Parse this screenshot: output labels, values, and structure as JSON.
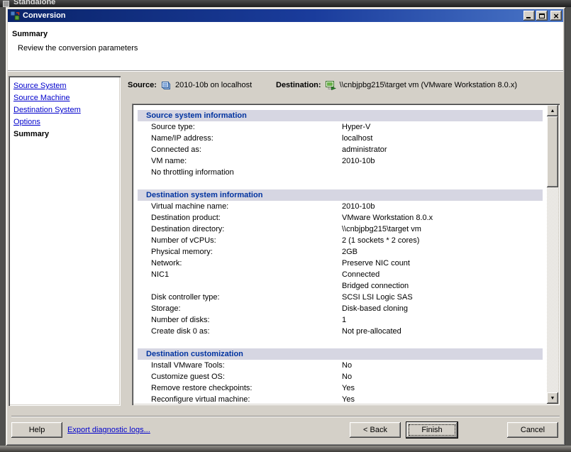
{
  "parent_window": {
    "title_visible": "Standalone"
  },
  "window": {
    "title": "Conversion"
  },
  "header": {
    "title": "Summary",
    "subtitle": "Review the conversion parameters"
  },
  "sidebar": {
    "items": [
      {
        "label": "Source System",
        "current": false
      },
      {
        "label": "Source Machine",
        "current": false
      },
      {
        "label": "Destination System",
        "current": false
      },
      {
        "label": "Options",
        "current": false
      },
      {
        "label": "Summary",
        "current": true
      }
    ]
  },
  "summary_bar": {
    "source_label": "Source:",
    "source_value": "2010-10b on localhost",
    "destination_label": "Destination:",
    "destination_value": "\\\\cnbjpbg215\\target vm (VMware Workstation 8.0.x)"
  },
  "content": {
    "sections": [
      {
        "title": "Source system information",
        "rows": [
          {
            "label": "Source type:",
            "value": "Hyper-V"
          },
          {
            "label": "Name/IP address:",
            "value": "localhost"
          },
          {
            "label": "Connected as:",
            "value": "administrator"
          },
          {
            "label": "VM name:",
            "value": "2010-10b"
          },
          {
            "label": "No throttling information",
            "value": ""
          }
        ]
      },
      {
        "title": "Destination system information",
        "rows": [
          {
            "label": "Virtual machine name:",
            "value": "2010-10b"
          },
          {
            "label": "Destination product:",
            "value": "VMware Workstation 8.0.x"
          },
          {
            "label": "Destination directory:",
            "value": "\\\\cnbjpbg215\\target vm"
          },
          {
            "label": "Number of vCPUs:",
            "value": "2 (1 sockets * 2 cores)"
          },
          {
            "label": "Physical memory:",
            "value": "2GB"
          },
          {
            "label": "Network:",
            "value": "Preserve NIC count"
          },
          {
            "label": "NIC1",
            "value": "Connected"
          },
          {
            "label": "",
            "value": "Bridged connection"
          },
          {
            "label": "Disk controller type:",
            "value": "SCSI LSI Logic SAS"
          },
          {
            "label": "Storage:",
            "value": "Disk-based cloning"
          },
          {
            "label": "Number of disks:",
            "value": "1"
          },
          {
            "label": "Create disk 0 as:",
            "value": "Not pre-allocated"
          }
        ]
      },
      {
        "title": "Destination customization",
        "rows": [
          {
            "label": "Install VMware Tools:",
            "value": "No"
          },
          {
            "label": "Customize guest OS:",
            "value": "No"
          },
          {
            "label": "Remove restore checkpoints:",
            "value": "Yes"
          },
          {
            "label": "Reconfigure virtual machine:",
            "value": "Yes"
          }
        ]
      }
    ]
  },
  "footer": {
    "help_button": "Help",
    "export_link": "Export diagnostic logs...",
    "back_button": "< Back",
    "finish_button": "Finish",
    "cancel_button": "Cancel"
  },
  "icons": {
    "app": "converter-app-icon",
    "minimize": "minimize-icon",
    "maximize": "maximize-icon",
    "close": "close-icon",
    "source": "source-host-icon",
    "destination": "destination-vm-icon",
    "scroll_up": "scroll-up-icon",
    "scroll_down": "scroll-down-icon"
  },
  "colors": {
    "titlebar_left": "#0a246a",
    "titlebar_right": "#4a76c8",
    "dialog_bg": "#d4d0c8",
    "link": "#0000cc",
    "section_header_text": "#0033a0",
    "section_header_bg": "#d6d6e2"
  }
}
